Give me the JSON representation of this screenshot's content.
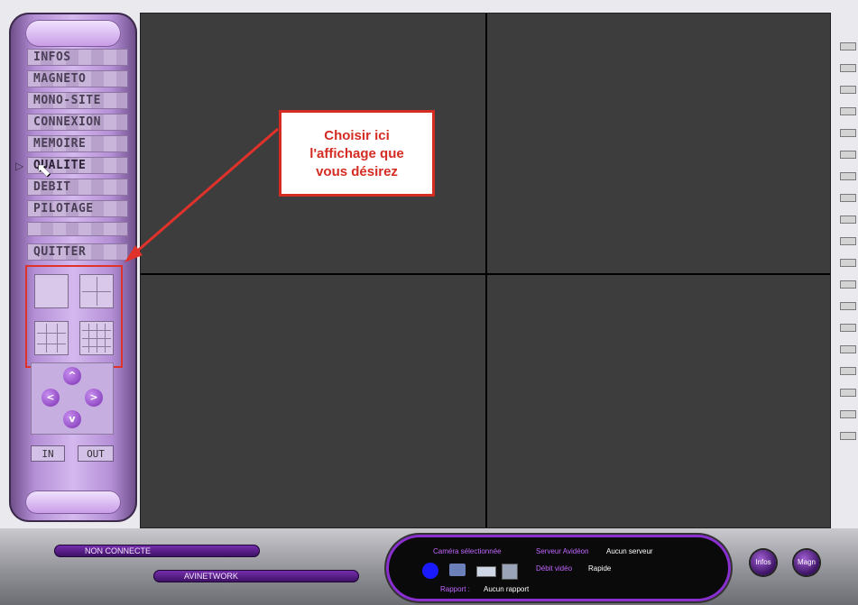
{
  "sidebar": {
    "menu": [
      {
        "label": "INFOS"
      },
      {
        "label": "MAGNETO"
      },
      {
        "label": "MONO-SITE"
      },
      {
        "label": "CONNEXION"
      },
      {
        "label": "MEMOIRE"
      },
      {
        "label": "QUALITE"
      },
      {
        "label": "DEBIT"
      },
      {
        "label": "PILOTAGE"
      },
      {
        "label": "QUITTER"
      }
    ],
    "active_item": "QUALITE",
    "dpad": {
      "up": "^",
      "left": "<",
      "right": ">",
      "down": "v"
    },
    "zoom_in": "IN",
    "zoom_out": "OUT"
  },
  "callout": {
    "line1": "Choisir ici",
    "line2": "l'affichage que",
    "line3": "vous désirez"
  },
  "status": {
    "connection": "NON CONNECTE",
    "network": "AVINETWORK",
    "camera_label": "Caméra sélectionnée",
    "server_label": "Serveur Avidéon",
    "server_value": "Aucun serveur",
    "debit_label": "Débit vidéo",
    "debit_value": "Rapide",
    "rapport_label": "Rapport :",
    "rapport_value": "Aucun rapport"
  },
  "buttons": {
    "infos": "Infos",
    "magneto": "Magn"
  },
  "colors": {
    "accent": "#d42b22",
    "sidebar": "#b48fd6",
    "video_bg": "#3d3d3d"
  }
}
